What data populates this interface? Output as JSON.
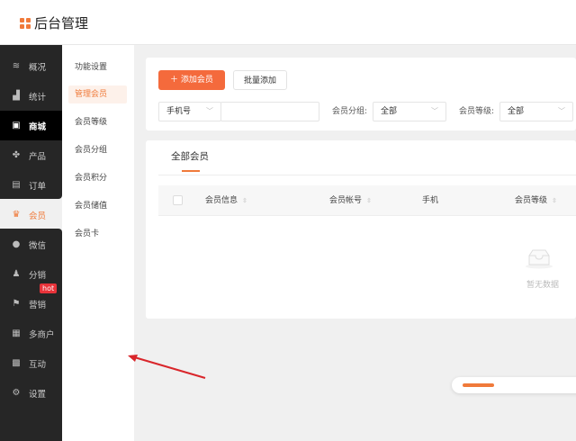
{
  "header": {
    "title": "后台管理"
  },
  "sidebar": {
    "items": [
      {
        "label": "概况",
        "icon": "layers-icon"
      },
      {
        "label": "统计",
        "icon": "chart-icon"
      },
      {
        "label": "商城",
        "icon": "store-icon"
      },
      {
        "label": "产品",
        "icon": "grid-icon"
      },
      {
        "label": "订单",
        "icon": "clipboard-icon"
      },
      {
        "label": "会员",
        "icon": "crown-icon"
      },
      {
        "label": "微信",
        "icon": "wechat-icon"
      },
      {
        "label": "分销",
        "icon": "users-icon"
      },
      {
        "label": "营销",
        "icon": "flag-icon",
        "badge": "hot"
      },
      {
        "label": "多商户",
        "icon": "merchant-icon"
      },
      {
        "label": "互动",
        "icon": "interaction-icon"
      },
      {
        "label": "设置",
        "icon": "gear-icon"
      }
    ]
  },
  "submenu": {
    "items": [
      "功能设置",
      "管理会员",
      "会员等级",
      "会员分组",
      "会员积分",
      "会员储值",
      "会员卡"
    ]
  },
  "toolbar": {
    "add_label": "添加会员",
    "batch_label": "批量添加"
  },
  "filters": {
    "search_type": "手机号",
    "search_value": "",
    "group_label": "会员分组:",
    "group_value": "全部",
    "level_label": "会员等级:",
    "level_value": "全部"
  },
  "tabs": {
    "all": "全部会员"
  },
  "table": {
    "columns": [
      "会员信息",
      "会员帐号",
      "手机",
      "会员等级"
    ],
    "empty": "暂无数据"
  },
  "colors": {
    "accent": "#f46a3c",
    "sidebar": "#262626"
  }
}
